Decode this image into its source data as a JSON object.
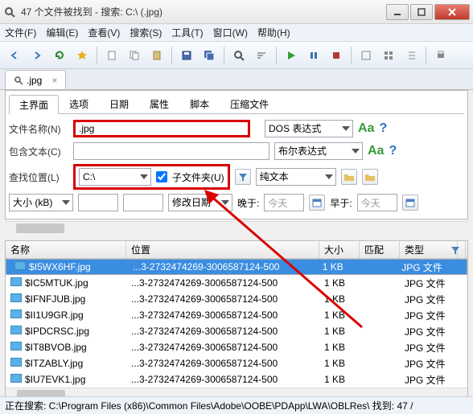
{
  "window": {
    "title": "47 个文件被找到 - 搜索: C:\\ (.jpg)"
  },
  "menu": [
    "文件(F)",
    "编辑(E)",
    "查看(V)",
    "搜索(S)",
    "工具(T)",
    "窗口(W)",
    "帮助(H)"
  ],
  "filetab": {
    "label": ".jpg"
  },
  "subtabs": [
    "主界面",
    "选项",
    "日期",
    "属性",
    "脚本",
    "压缩文件"
  ],
  "form": {
    "name_label": "文件名称(N)",
    "name_value": ".jpg",
    "name_mode": "DOS 表达式",
    "text_label": "包含文本(C)",
    "text_value": "",
    "text_mode": "布尔表达式",
    "loc_label": "查找位置(L)",
    "loc_value": "C:\\",
    "subfolder_label": "子文件夹(U)",
    "plain_text": "纯文本",
    "size_label": "大小 (kB)",
    "date_label": "修改日期",
    "later_label": "晚于:",
    "earlier_label": "早于:",
    "today": "今天"
  },
  "columns": {
    "name": "名称",
    "location": "位置",
    "size": "大小",
    "match": "匹配",
    "type": "类型"
  },
  "rows": [
    {
      "name": "$I5WX6HF.jpg",
      "loc": "...3-2732474269-3006587124-500",
      "size": "1 KB",
      "type": "JPG 文件",
      "sel": true
    },
    {
      "name": "$IC5MTUK.jpg",
      "loc": "...3-2732474269-3006587124-500",
      "size": "1 KB",
      "type": "JPG 文件"
    },
    {
      "name": "$IFNFJUB.jpg",
      "loc": "...3-2732474269-3006587124-500",
      "size": "1 KB",
      "type": "JPG 文件"
    },
    {
      "name": "$II1U9GR.jpg",
      "loc": "...3-2732474269-3006587124-500",
      "size": "1 KB",
      "type": "JPG 文件"
    },
    {
      "name": "$IPDCRSC.jpg",
      "loc": "...3-2732474269-3006587124-500",
      "size": "1 KB",
      "type": "JPG 文件"
    },
    {
      "name": "$IT8BVOB.jpg",
      "loc": "...3-2732474269-3006587124-500",
      "size": "1 KB",
      "type": "JPG 文件"
    },
    {
      "name": "$ITZABLY.jpg",
      "loc": "...3-2732474269-3006587124-500",
      "size": "1 KB",
      "type": "JPG 文件"
    },
    {
      "name": "$IU7EVK1.jpg",
      "loc": "...3-2732474269-3006587124-500",
      "size": "1 KB",
      "type": "JPG 文件"
    }
  ],
  "status": "正在搜索: C:\\Program Files (x86)\\Common Files\\Adobe\\OOBE\\PDApp\\LWA\\OBLRes\\ 找到: 47 /"
}
